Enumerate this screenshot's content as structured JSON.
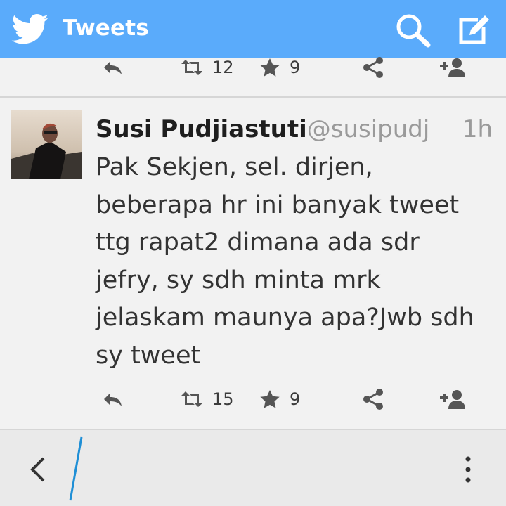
{
  "header": {
    "title": "Tweets",
    "icons": [
      "twitter-bird-icon",
      "search-icon",
      "compose-icon"
    ],
    "color": "#5aabfb"
  },
  "prev_tweet": {
    "retweets": "12",
    "favorites": "9"
  },
  "tweet": {
    "author": "Susi Pudjiastuti",
    "handle": "@susipudj",
    "time": "1h",
    "lines": [
      "Pak Sekjen, sel. dirjen,",
      "beberapa hr ini banyak tweet",
      "ttg rapat2 dimana ada sdr",
      "jefry, sy sdh minta mrk",
      "jelaskam maunya apa?Jwb sdh",
      "sy tweet"
    ],
    "retweets": "15",
    "favorites": "9"
  },
  "bottom_bar": {
    "icons": [
      "back-icon",
      "overflow-menu-icon"
    ]
  }
}
